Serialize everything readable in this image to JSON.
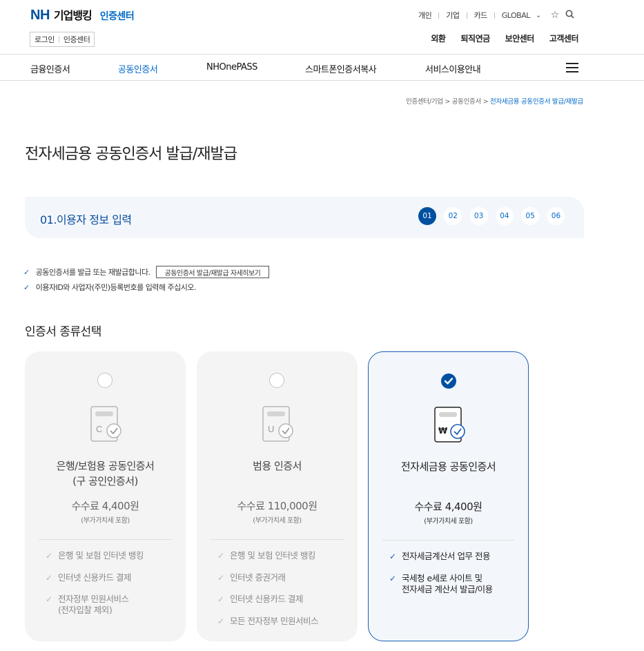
{
  "header": {
    "logo_nh": "NH",
    "logo_bank": "기업뱅킹",
    "logo_sub": "인증센터",
    "login_label": "로그인",
    "cert_center_label": "인증센터",
    "util_links": [
      "개인",
      "기업",
      "카드"
    ],
    "global_label": "GLOBAL",
    "icons": [
      "chevron-down-icon",
      "star-icon",
      "search-icon"
    ],
    "service_menu": [
      "외환",
      "퇴직연금",
      "보안센터",
      "고객센터"
    ]
  },
  "gnb": {
    "items": [
      {
        "label": "금융인증서",
        "active": false
      },
      {
        "label": "공동인증서",
        "active": true
      },
      {
        "label": "NHOnePASS",
        "active": false
      },
      {
        "label": "스마트폰인증서복사",
        "active": false
      },
      {
        "label": "서비스이용안내",
        "active": false
      }
    ],
    "menu_icon": "hamburger-menu-icon"
  },
  "breadcrumb": {
    "path": "인증센터/기업 > 공동인증서 > ",
    "current": "전자세금용 공동인증서 발급/재발급"
  },
  "page_title": "전자세금용 공동인증서 발급/재발급",
  "stepbar": {
    "title": "01.이용자 정보 입력",
    "steps": [
      "01",
      "02",
      "03",
      "04",
      "05",
      "06"
    ],
    "active_step": "01"
  },
  "notes": {
    "line1": "공동인증서를 발급 또는 재발급합니다.",
    "detail_button": "공동인증서 발급/재발급 자세히보기",
    "line2": "이용자ID와 사업자(주민)등록번호를 입력해 주십시오."
  },
  "section_title": "인증서 종류선택",
  "cards": [
    {
      "icon_letter": "C",
      "name_line1": "은행/보험용 공동인증서",
      "name_line2": "(구 공인인증서)",
      "fee": "수수료 4,400원",
      "vat": "(부가가치세 포함)",
      "selected": false,
      "features": [
        "은행 및 보험 인터넷 뱅킹",
        "인터넷 신용카드 결제",
        "전자정부 민원서비스\n(전자입찰 제외)"
      ]
    },
    {
      "icon_letter": "U",
      "name_line1": "범용 인증서",
      "name_line2": "",
      "fee": "수수료 110,000원",
      "vat": "(부가가치세 포함)",
      "selected": false,
      "features": [
        "은행 및 보험 인터넷 뱅킹",
        "인터넷 증권거래",
        "인터넷 신용카드 결제",
        "모든 전자정부 민원서비스"
      ]
    },
    {
      "icon_letter": "₩",
      "name_line1": "전자세금용 공동인증서",
      "name_line2": "",
      "fee": "수수료 4,400원",
      "vat": "(부가가치세 포함)",
      "selected": true,
      "features": [
        "전자세금계산서 업무 전용",
        "국세청 e세로 사이트 및\n전자세금 계산서 발급/이용"
      ]
    }
  ]
}
